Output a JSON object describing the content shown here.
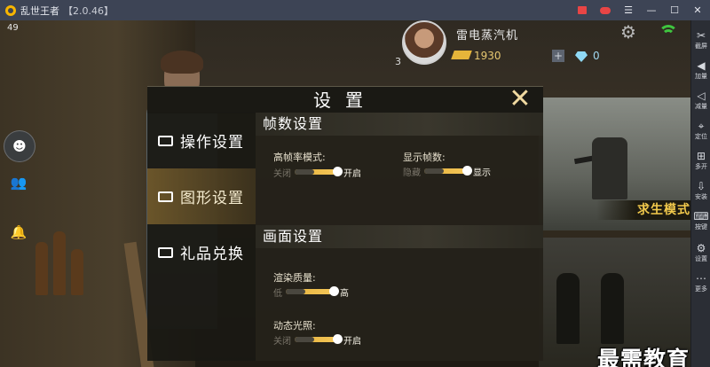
{
  "window": {
    "title": "乱世王者",
    "version": "【2.0.46】"
  },
  "game": {
    "fps": "49",
    "player": {
      "name": "雷电蒸汽机",
      "level": "3",
      "gold": "1930",
      "gems": "0"
    },
    "promo_label": "求生模式"
  },
  "settings": {
    "title": "设置",
    "nav": [
      "操作设置",
      "图形设置",
      "礼品兑换"
    ],
    "active_nav": "图形设置",
    "sections": {
      "frame": {
        "title": "帧数设置",
        "high_fps": {
          "label": "高帧率模式:",
          "off": "关闭",
          "on": "开启",
          "value": "开启"
        },
        "show_fps": {
          "label": "显示帧数:",
          "off": "隐藏",
          "on": "显示",
          "value": "显示"
        }
      },
      "display": {
        "title": "画面设置",
        "quality": {
          "label": "渲染质量:",
          "off": "低",
          "on": "高",
          "value": "高"
        },
        "lighting": {
          "label": "动态光照:",
          "off": "关闭",
          "on": "开启",
          "value": "开启"
        }
      }
    }
  },
  "sidebar": [
    {
      "label": "截屏",
      "icon": "scissors-icon"
    },
    {
      "label": "加量",
      "icon": "volume-up-icon"
    },
    {
      "label": "减量",
      "icon": "volume-down-icon"
    },
    {
      "label": "定位",
      "icon": "location-icon"
    },
    {
      "label": "多开",
      "icon": "multi-window-icon"
    },
    {
      "label": "安装",
      "icon": "install-icon"
    },
    {
      "label": "按键",
      "icon": "keyboard-icon"
    },
    {
      "label": "设置",
      "icon": "gear-icon"
    },
    {
      "label": "更多",
      "icon": "more-icon"
    }
  ],
  "watermark": "最需教育",
  "colors": {
    "accent": "#f0c54a",
    "titlebar": "#3d4455",
    "sidebar": "#2b2e35",
    "wifi": "#3fc43f"
  }
}
